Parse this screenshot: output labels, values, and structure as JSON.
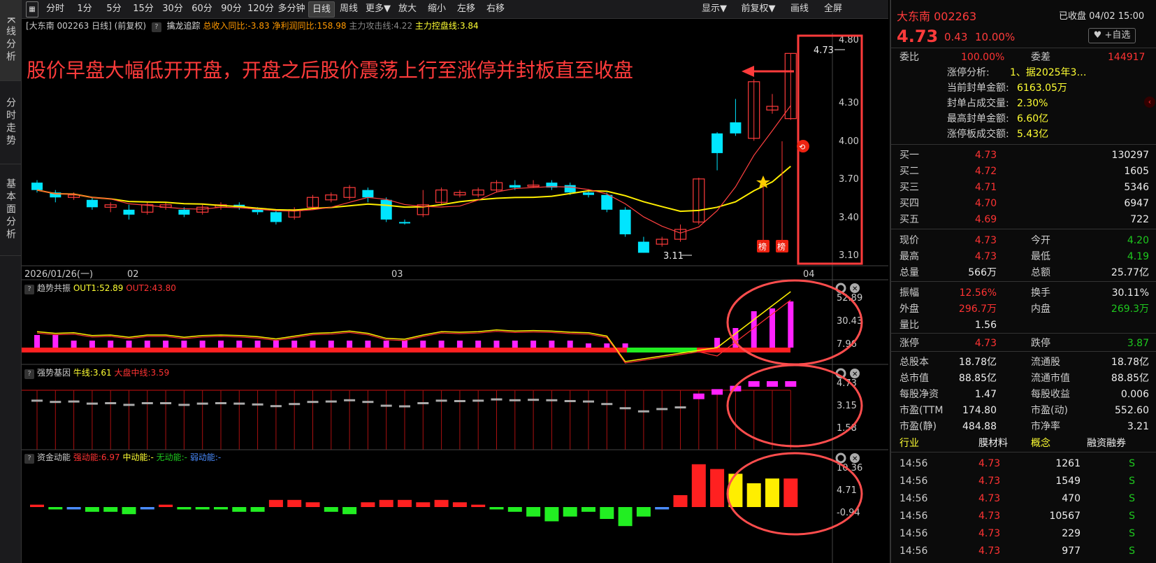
{
  "rail": [
    "K线分析",
    "分时走势",
    "基本面分析"
  ],
  "toolbar": {
    "left_buttons": [
      "分时",
      "1分",
      "5分",
      "15分",
      "30分",
      "60分",
      "90分",
      "120分",
      "多分钟",
      "日线",
      "周线",
      "更多▼",
      "放大",
      "缩小",
      "左移",
      "右移"
    ],
    "active": "日线",
    "right_buttons": [
      "显示▼",
      "前复权▼",
      "画线",
      "全屏"
    ]
  },
  "info": {
    "stock": "[大东南 002263 日线]",
    "adjust": "(前复权)",
    "help": "?",
    "indicator": "擒龙追踪",
    "rev": "总收入同比:-3.83",
    "profit": "净利润同比:158.98",
    "attack": "主力攻击线:4.22",
    "control": "主力控盘线:3.84"
  },
  "annotation": "股价早盘大幅低开开盘，开盘之后股价震荡上行至涨停并封板直至收盘",
  "price_axis": [
    "4.80",
    "4.30",
    "4.00",
    "3.70",
    "3.40",
    "3.10"
  ],
  "date_axis": {
    "start": "2026/01/26(一)",
    "m2": "02",
    "m3": "03",
    "m4": "04"
  },
  "marks": {
    "high": "4.73",
    "low": "3.11",
    "bang": "榜"
  },
  "ind1": {
    "name": "趋势共振",
    "out1": "OUT1:52.89",
    "out2": "OUT2:43.80",
    "axis": [
      "52.89",
      "30.43",
      "7.96"
    ]
  },
  "ind2": {
    "name": "强势基因",
    "bull": "牛线:3.61",
    "market": "大盘中线:3.59",
    "axis": [
      "4.73",
      "3.15",
      "1.58"
    ]
  },
  "ind3": {
    "name": "资金动能",
    "strong": "强动能:6.97",
    "mid": "中动能:-",
    "none": "无动能:-",
    "weak": "弱动能:-",
    "axis": [
      "10.36",
      "4.71",
      "-0.94"
    ]
  },
  "chart_data": {
    "type": "candlestick",
    "ylim": [
      3.05,
      4.84
    ],
    "candles": [
      [
        3.68,
        3.62,
        3.7,
        3.6
      ],
      [
        3.6,
        3.56,
        3.62,
        3.52
      ],
      [
        3.56,
        3.58,
        3.6,
        3.54
      ],
      [
        3.54,
        3.48,
        3.56,
        3.46
      ],
      [
        3.48,
        3.5,
        3.52,
        3.44
      ],
      [
        3.46,
        3.42,
        3.5,
        3.38
      ],
      [
        3.44,
        3.5,
        3.52,
        3.42
      ],
      [
        3.48,
        3.5,
        3.52,
        3.46
      ],
      [
        3.46,
        3.42,
        3.48,
        3.4
      ],
      [
        3.44,
        3.48,
        3.5,
        3.42
      ],
      [
        3.48,
        3.5,
        3.52,
        3.46
      ],
      [
        3.5,
        3.48,
        3.52,
        3.46
      ],
      [
        3.46,
        3.44,
        3.48,
        3.42
      ],
      [
        3.44,
        3.36,
        3.46,
        3.34
      ],
      [
        3.4,
        3.46,
        3.48,
        3.38
      ],
      [
        3.48,
        3.56,
        3.58,
        3.46
      ],
      [
        3.54,
        3.58,
        3.6,
        3.52
      ],
      [
        3.56,
        3.64,
        3.66,
        3.54
      ],
      [
        3.62,
        3.56,
        3.64,
        3.52
      ],
      [
        3.54,
        3.38,
        3.56,
        3.36
      ],
      [
        3.36,
        3.35,
        3.38,
        3.34
      ],
      [
        3.42,
        3.5,
        3.62,
        3.4
      ],
      [
        3.52,
        3.62,
        3.64,
        3.5
      ],
      [
        3.58,
        3.6,
        3.62,
        3.56
      ],
      [
        3.58,
        3.62,
        3.64,
        3.56
      ],
      [
        3.62,
        3.68,
        3.7,
        3.6
      ],
      [
        3.66,
        3.64,
        3.7,
        3.62
      ],
      [
        3.66,
        3.66,
        3.7,
        3.64
      ],
      [
        3.68,
        3.64,
        3.7,
        3.62
      ],
      [
        3.66,
        3.6,
        3.68,
        3.58
      ],
      [
        3.6,
        3.58,
        3.62,
        3.56
      ],
      [
        3.58,
        3.46,
        3.6,
        3.44
      ],
      [
        3.46,
        3.26,
        3.48,
        3.24
      ],
      [
        3.2,
        3.11,
        3.24,
        3.11
      ],
      [
        3.18,
        3.22,
        3.24,
        3.16
      ],
      [
        3.22,
        3.3,
        3.34,
        3.2
      ],
      [
        3.36,
        3.71,
        3.72,
        3.34
      ],
      [
        4.08,
        3.92,
        4.09,
        3.78
      ],
      [
        4.17,
        4.08,
        4.36,
        4.06
      ],
      [
        4.04,
        4.5,
        4.52,
        4.02
      ],
      [
        4.27,
        4.3,
        4.4,
        4.24
      ],
      [
        4.2,
        4.73,
        4.73,
        4.19
      ]
    ]
  }
}
